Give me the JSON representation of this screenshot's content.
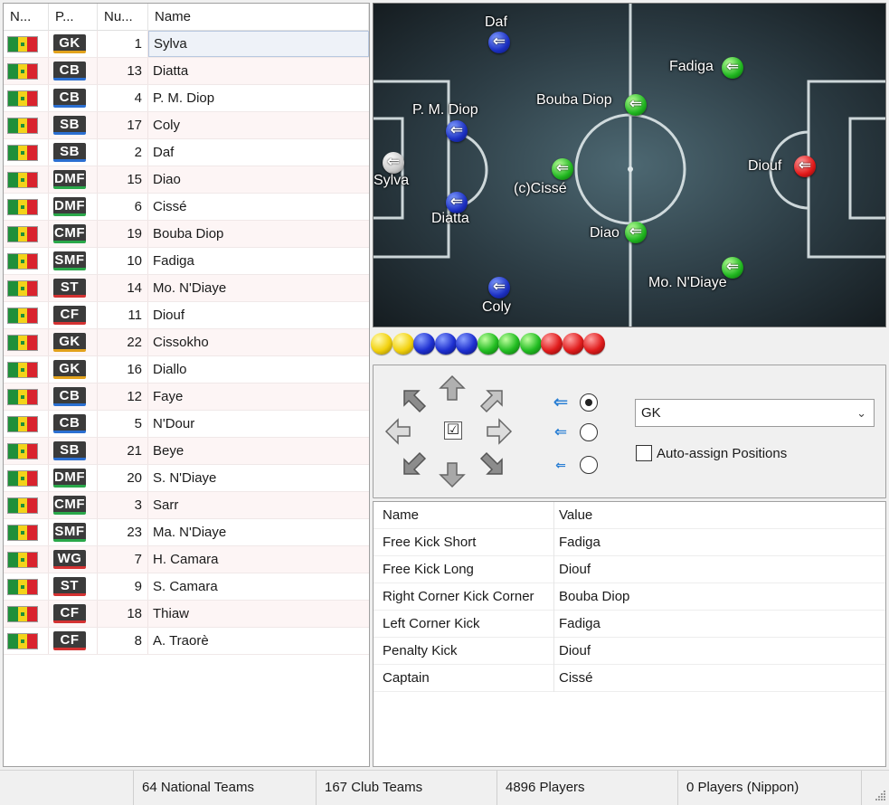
{
  "player_list": {
    "columns": [
      "N...",
      "P...",
      "Nu...",
      "Name"
    ],
    "players": [
      {
        "position": "GK",
        "number": "1",
        "name": "Sylva",
        "selected": true
      },
      {
        "position": "CB",
        "number": "13",
        "name": "Diatta"
      },
      {
        "position": "CB",
        "number": "4",
        "name": "P. M. Diop"
      },
      {
        "position": "SB",
        "number": "17",
        "name": "Coly"
      },
      {
        "position": "SB",
        "number": "2",
        "name": "Daf"
      },
      {
        "position": "DMF",
        "number": "15",
        "name": "Diao"
      },
      {
        "position": "DMF",
        "number": "6",
        "name": "Cissé"
      },
      {
        "position": "CMF",
        "number": "19",
        "name": "Bouba Diop"
      },
      {
        "position": "SMF",
        "number": "10",
        "name": "Fadiga"
      },
      {
        "position": "ST",
        "number": "14",
        "name": "Mo. N'Diaye"
      },
      {
        "position": "CF",
        "number": "11",
        "name": "Diouf"
      },
      {
        "position": "GK",
        "number": "22",
        "name": "Cissokho"
      },
      {
        "position": "GK",
        "number": "16",
        "name": "Diallo"
      },
      {
        "position": "CB",
        "number": "12",
        "name": "Faye"
      },
      {
        "position": "CB",
        "number": "5",
        "name": "N'Dour"
      },
      {
        "position": "SB",
        "number": "21",
        "name": "Beye"
      },
      {
        "position": "DMF",
        "number": "20",
        "name": "S. N'Diaye"
      },
      {
        "position": "CMF",
        "number": "3",
        "name": "Sarr"
      },
      {
        "position": "SMF",
        "number": "23",
        "name": "Ma. N'Diaye"
      },
      {
        "position": "WG",
        "number": "7",
        "name": "H. Camara"
      },
      {
        "position": "ST",
        "number": "9",
        "name": "S. Camara"
      },
      {
        "position": "CF",
        "number": "18",
        "name": "Thiaw"
      },
      {
        "position": "CF",
        "number": "8",
        "name": "A. Traorè"
      }
    ]
  },
  "pitch": {
    "players": [
      {
        "label": "Daf",
        "color": "blue",
        "arrow": "⇐"
      },
      {
        "label": "Fadiga",
        "color": "green",
        "arrow": "⇐"
      },
      {
        "label": "Bouba Diop",
        "color": "green",
        "arrow": "⇐"
      },
      {
        "label": "P. M. Diop",
        "color": "blue",
        "arrow": "⇐"
      },
      {
        "label": "Sylva",
        "color": "gray",
        "arrow": "⇐"
      },
      {
        "label": "(c)Cissé",
        "color": "green",
        "arrow": "⇐"
      },
      {
        "label": "Diouf",
        "color": "red",
        "arrow": "⇐"
      },
      {
        "label": "Diatta",
        "color": "blue",
        "arrow": "⇐"
      },
      {
        "label": "Diao",
        "color": "green",
        "arrow": "⇐"
      },
      {
        "label": "Mo. N'Diaye",
        "color": "green",
        "arrow": "⇐"
      },
      {
        "label": "Coly",
        "color": "blue",
        "arrow": "⇐"
      }
    ]
  },
  "palette": [
    "yellow",
    "yellow",
    "blue",
    "blue",
    "blue",
    "green",
    "green",
    "green",
    "red",
    "red",
    "red"
  ],
  "controls": {
    "position_select": "GK",
    "auto_assign_label": "Auto-assign Positions",
    "auto_assign_checked": false,
    "speed_options": [
      "⇐",
      "⇐",
      "⇐"
    ],
    "speed_selected": 0
  },
  "roles": {
    "columns": [
      "Name",
      "Value"
    ],
    "rows": [
      {
        "name": "Free Kick Short",
        "value": "Fadiga"
      },
      {
        "name": "Free Kick Long",
        "value": "Diouf"
      },
      {
        "name": "Right Corner Kick Corner",
        "value": "Bouba Diop"
      },
      {
        "name": "Left Corner Kick",
        "value": "Fadiga"
      },
      {
        "name": "Penalty Kick",
        "value": "Diouf"
      },
      {
        "name": "Captain",
        "value": "Cissé"
      }
    ]
  },
  "status_bar": {
    "national_teams": "64 National Teams",
    "club_teams": "167 Club Teams",
    "players": "4896 Players",
    "nippon": "0 Players (Nippon)"
  },
  "colors": {
    "flag_green": "#1f8f3a",
    "flag_yellow": "#f3d31a",
    "flag_red": "#d9232e",
    "badge_bg": "#3b3b3b",
    "selection_bg": "#eef2f8"
  }
}
